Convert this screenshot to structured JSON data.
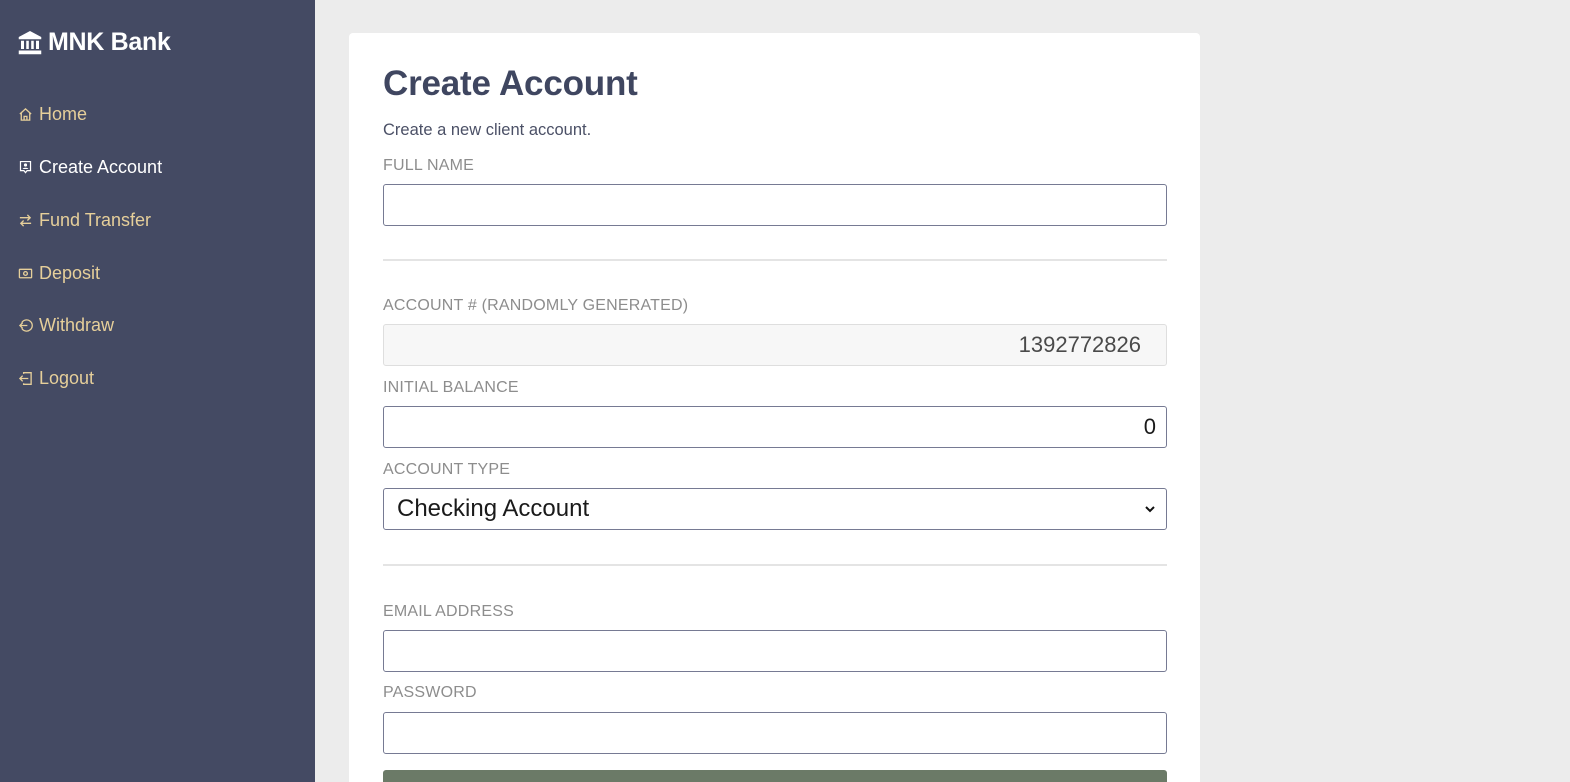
{
  "app": {
    "brand": "MNK Bank",
    "brand_icon": "bank-icon"
  },
  "sidebar": {
    "items": [
      {
        "label": "Home",
        "icon": "home-icon",
        "active": false
      },
      {
        "label": "Create Account",
        "icon": "person-badge-icon",
        "active": true
      },
      {
        "label": "Fund Transfer",
        "icon": "arrows-exchange-icon",
        "active": false
      },
      {
        "label": "Deposit",
        "icon": "cash-icon",
        "active": false
      },
      {
        "label": "Withdraw",
        "icon": "box-arrow-left-icon",
        "active": false
      },
      {
        "label": "Logout",
        "icon": "box-arrow-in-left-icon",
        "active": false
      }
    ]
  },
  "form": {
    "title": "Create Account",
    "subtitle": "Create a new client account.",
    "full_name": {
      "label": "FULL NAME",
      "value": ""
    },
    "account_number": {
      "label": "ACCOUNT # (RANDOMLY GENERATED)",
      "value": "1392772826"
    },
    "initial_balance": {
      "label": "INITIAL BALANCE",
      "value": "0"
    },
    "account_type": {
      "label": "ACCOUNT TYPE",
      "selected": "Checking Account"
    },
    "email": {
      "label": "EMAIL ADDRESS",
      "value": ""
    },
    "password": {
      "label": "PASSWORD",
      "value": ""
    },
    "submit_label": ""
  },
  "colors": {
    "sidebar_bg": "#444a63",
    "nav_text": "#e6cf9a",
    "nav_active_text": "#ffffff",
    "page_bg": "#ececec",
    "title": "#3f4660",
    "submit_bg": "#6b7a67"
  }
}
